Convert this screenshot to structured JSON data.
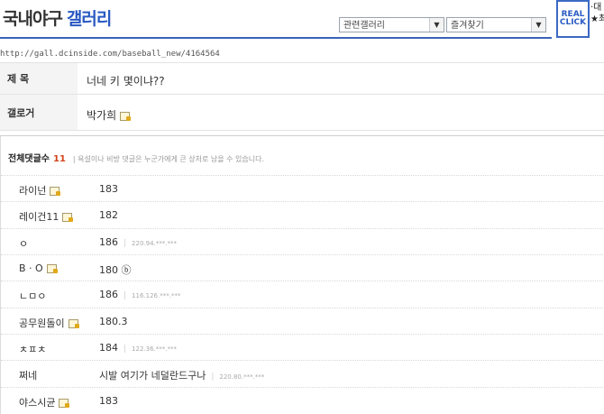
{
  "header": {
    "title_main": "국내야구",
    "title_accent": "갤러리",
    "select_related": "관련갤러리",
    "select_favorites": "즐겨찾기",
    "realclick_line1": "REAL",
    "realclick_line2": "CLICK",
    "ad_right_line1": "·대",
    "ad_right_line2": "★최"
  },
  "url": "http://gall.dcinside.com/baseball_new/4164564",
  "post": {
    "subject_label": "제 목",
    "subject_value": "너네 키 몇이냐??",
    "author_label": "갤로거",
    "author_value": "박가희"
  },
  "comments": {
    "count_label": "전체댓글수",
    "count": "11",
    "notice": "| 욕설이나 비방 댓글은 누군가에게 큰 상처로 남을 수 있습니다.",
    "items": [
      {
        "nick": "라이넌",
        "gallog_icon": true,
        "text": "183",
        "ip": ""
      },
      {
        "nick": "레이건11",
        "gallog_icon": true,
        "text": "182",
        "ip": ""
      },
      {
        "nick": "ㅇ",
        "gallog_icon": false,
        "text": "186",
        "ip": "220.94.***.***"
      },
      {
        "nick": "B · O",
        "gallog_icon": true,
        "text": "180 ⓑ",
        "ip": ""
      },
      {
        "nick": "ㄴㅁㅇ",
        "gallog_icon": false,
        "text": "186",
        "ip": "116.126.***.***"
      },
      {
        "nick": "공무원돌이",
        "gallog_icon": true,
        "text": "180.3",
        "ip": ""
      },
      {
        "nick": "ㅊㅍㅊ",
        "gallog_icon": false,
        "text": "184",
        "ip": "122.36.***.***"
      },
      {
        "nick": "쩌네",
        "gallog_icon": false,
        "text": "시발 여기가 네덜란드구나",
        "ip": "220.80.***.***"
      },
      {
        "nick": "야스시균",
        "gallog_icon": true,
        "text": "183",
        "ip": ""
      }
    ]
  }
}
